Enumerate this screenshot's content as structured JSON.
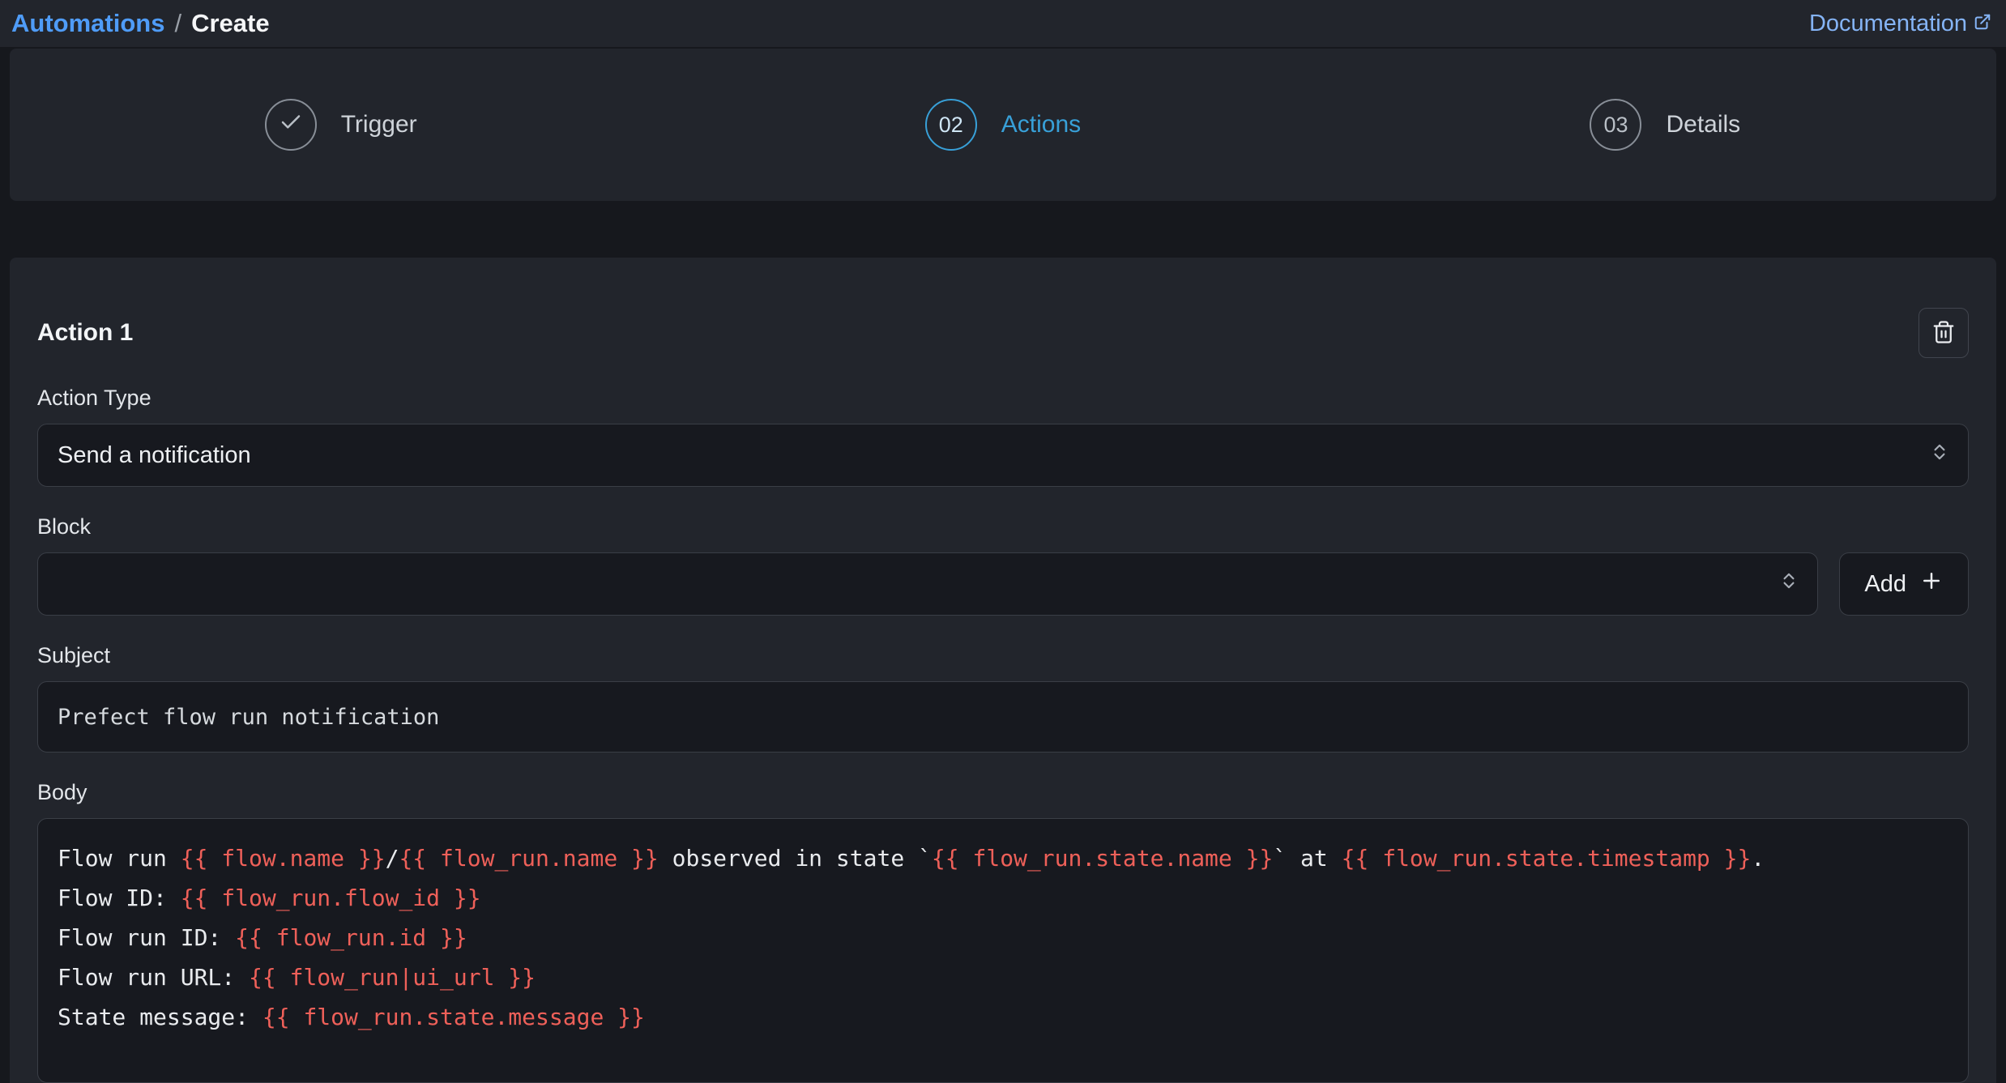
{
  "colors": {
    "accent-blue": "#4f9cf8",
    "link-blue": "#85b4f6",
    "step-active": "#38a0d8",
    "var-red": "#ee6059",
    "panel-bg": "#22252c",
    "page-bg": "#16181d"
  },
  "breadcrumb": {
    "section": "Automations",
    "separator": "/",
    "page": "Create"
  },
  "header": {
    "documentation_label": "Documentation"
  },
  "stepper": {
    "steps": [
      {
        "id": "trigger",
        "indicator": "check",
        "label": "Trigger",
        "state": "complete"
      },
      {
        "id": "actions",
        "indicator": "02",
        "label": "Actions",
        "state": "active"
      },
      {
        "id": "details",
        "indicator": "03",
        "label": "Details",
        "state": "upcoming"
      }
    ]
  },
  "action_card": {
    "title": "Action 1",
    "action_type": {
      "label": "Action Type",
      "value": "Send a notification"
    },
    "block": {
      "label": "Block",
      "value": "",
      "add_button_label": "Add"
    },
    "subject": {
      "label": "Subject",
      "value": "Prefect flow run notification"
    },
    "body": {
      "label": "Body",
      "lines": [
        [
          {
            "k": "text",
            "t": "Flow run "
          },
          {
            "k": "var",
            "t": "{{ flow.name }}"
          },
          {
            "k": "text",
            "t": "/"
          },
          {
            "k": "var",
            "t": "{{ flow_run.name }}"
          },
          {
            "k": "text",
            "t": " observed in state `"
          },
          {
            "k": "var",
            "t": "{{ flow_run.state.name }}"
          },
          {
            "k": "text",
            "t": "` at "
          },
          {
            "k": "var",
            "t": "{{ flow_run.state.timestamp }}"
          },
          {
            "k": "text",
            "t": "."
          }
        ],
        [
          {
            "k": "text",
            "t": "Flow ID: "
          },
          {
            "k": "var",
            "t": "{{ flow_run.flow_id }}"
          }
        ],
        [
          {
            "k": "text",
            "t": "Flow run ID: "
          },
          {
            "k": "var",
            "t": "{{ flow_run.id }}"
          }
        ],
        [
          {
            "k": "text",
            "t": "Flow run URL: "
          },
          {
            "k": "var",
            "t": "{{ flow_run|ui_url }}"
          }
        ],
        [
          {
            "k": "text",
            "t": "State message: "
          },
          {
            "k": "var",
            "t": "{{ flow_run.state.message }}"
          }
        ]
      ]
    }
  }
}
